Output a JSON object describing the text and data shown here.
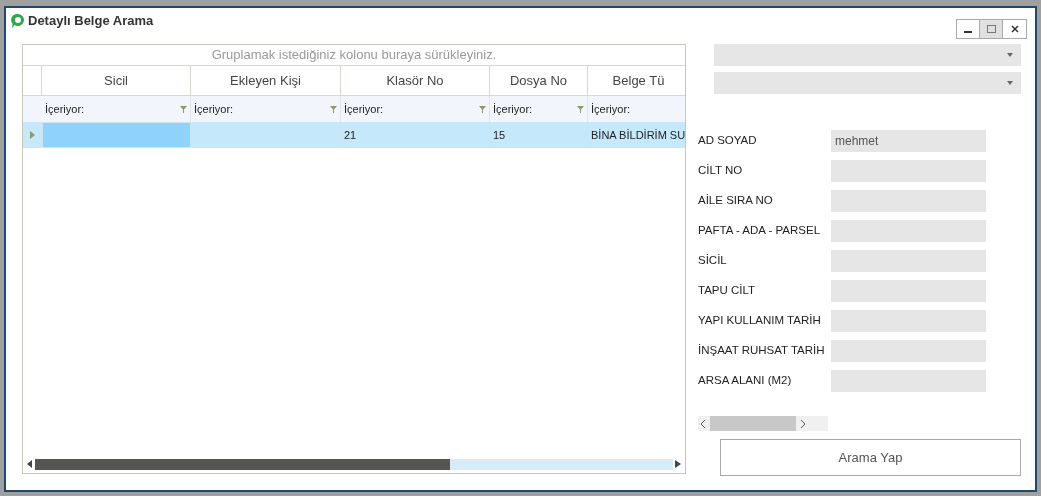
{
  "window": {
    "title": "Detaylı Belge Arama"
  },
  "grid": {
    "group_panel": "Gruplamak istediğiniz kolonu buraya sürükleyiniz.",
    "columns": [
      {
        "header": "Sicil",
        "filter": "İçeriyor:"
      },
      {
        "header": "Ekleyen Kişi",
        "filter": "İçeriyor:"
      },
      {
        "header": "Klasör No",
        "filter": "İçeriyor:"
      },
      {
        "header": "Dosya No",
        "filter": "İçeriyor:"
      },
      {
        "header": "Belge Tü",
        "filter": "İçeriyor:"
      }
    ],
    "rows": [
      {
        "selected": true,
        "cells": [
          {
            "focused": true
          },
          {
            "focused": false
          },
          {
            "text": "21",
            "focused": false
          },
          {
            "text": "15",
            "focused": false
          },
          {
            "text": "BİNA BİLDİRİM SU",
            "focused": false
          }
        ]
      }
    ]
  },
  "form": {
    "fields": [
      {
        "label": "AD SOYAD",
        "value": "mehmet"
      },
      {
        "label": "CİLT NO"
      },
      {
        "label": "AİLE SIRA NO"
      },
      {
        "label": "PAFTA - ADA - PARSEL"
      },
      {
        "label": "SİCİL"
      },
      {
        "label": "TAPU CİLT"
      },
      {
        "label": "YAPI KULLANIM TARİH"
      },
      {
        "label": "İNŞAAT RUHSAT TARİH"
      },
      {
        "label": "ARSA  ALANI (M2)"
      }
    ]
  },
  "search_button": "Arama Yap"
}
